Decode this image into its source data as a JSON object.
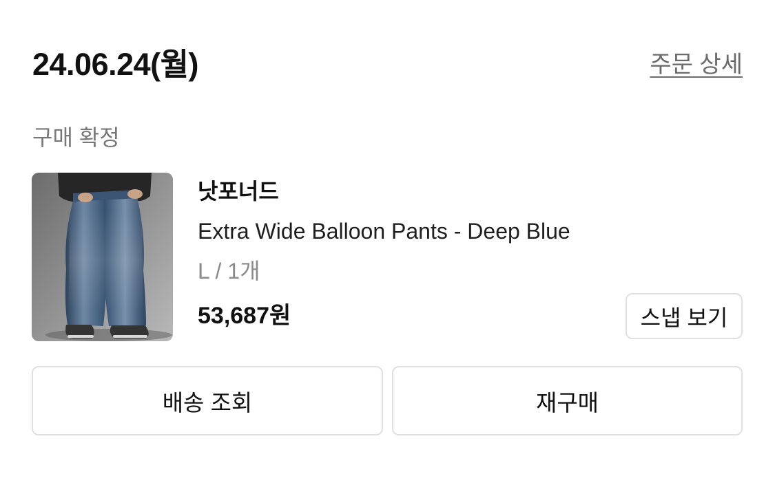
{
  "order": {
    "date": "24.06.24(월)",
    "detail_link": "주문 상세",
    "status": "구매 확정"
  },
  "product": {
    "image_icon": "product-photo",
    "brand": "낫포너드",
    "name": "Extra Wide Balloon Pants - Deep Blue",
    "option": "L / 1개",
    "price": "53,687원",
    "snap_button": "스냅 보기"
  },
  "actions": {
    "delivery": "배송 조회",
    "rebuy": "재구매"
  },
  "colors": {
    "text_primary": "#111111",
    "text_secondary": "#777777",
    "link": "#6b6b6b",
    "border": "#e0e0e0",
    "background": "#ffffff"
  }
}
